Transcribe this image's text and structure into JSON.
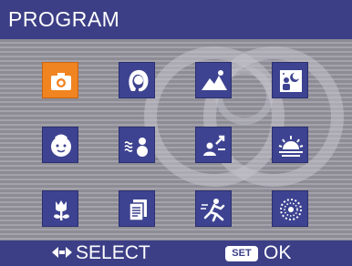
{
  "header": {
    "title": "PROGRAM"
  },
  "modes": [
    {
      "icon": "camera-icon",
      "selected": true
    },
    {
      "icon": "portrait-icon",
      "selected": false
    },
    {
      "icon": "landscape-icon",
      "selected": false
    },
    {
      "icon": "night-portrait-icon",
      "selected": false
    },
    {
      "icon": "child-icon",
      "selected": false
    },
    {
      "icon": "snow-icon",
      "selected": false
    },
    {
      "icon": "sports-icon",
      "selected": false
    },
    {
      "icon": "sunset-icon",
      "selected": false
    },
    {
      "icon": "macro-flower-icon",
      "selected": false
    },
    {
      "icon": "text-icon",
      "selected": false
    },
    {
      "icon": "action-runner-icon",
      "selected": false
    },
    {
      "icon": "fireworks-icon",
      "selected": false
    }
  ],
  "footer": {
    "select_label": "SELECT",
    "set_badge": "SET",
    "ok_label": "OK"
  },
  "colors": {
    "bar_blue": "#3c3f86",
    "tile_blue": "#3d4390",
    "selected_orange": "#f08420"
  }
}
